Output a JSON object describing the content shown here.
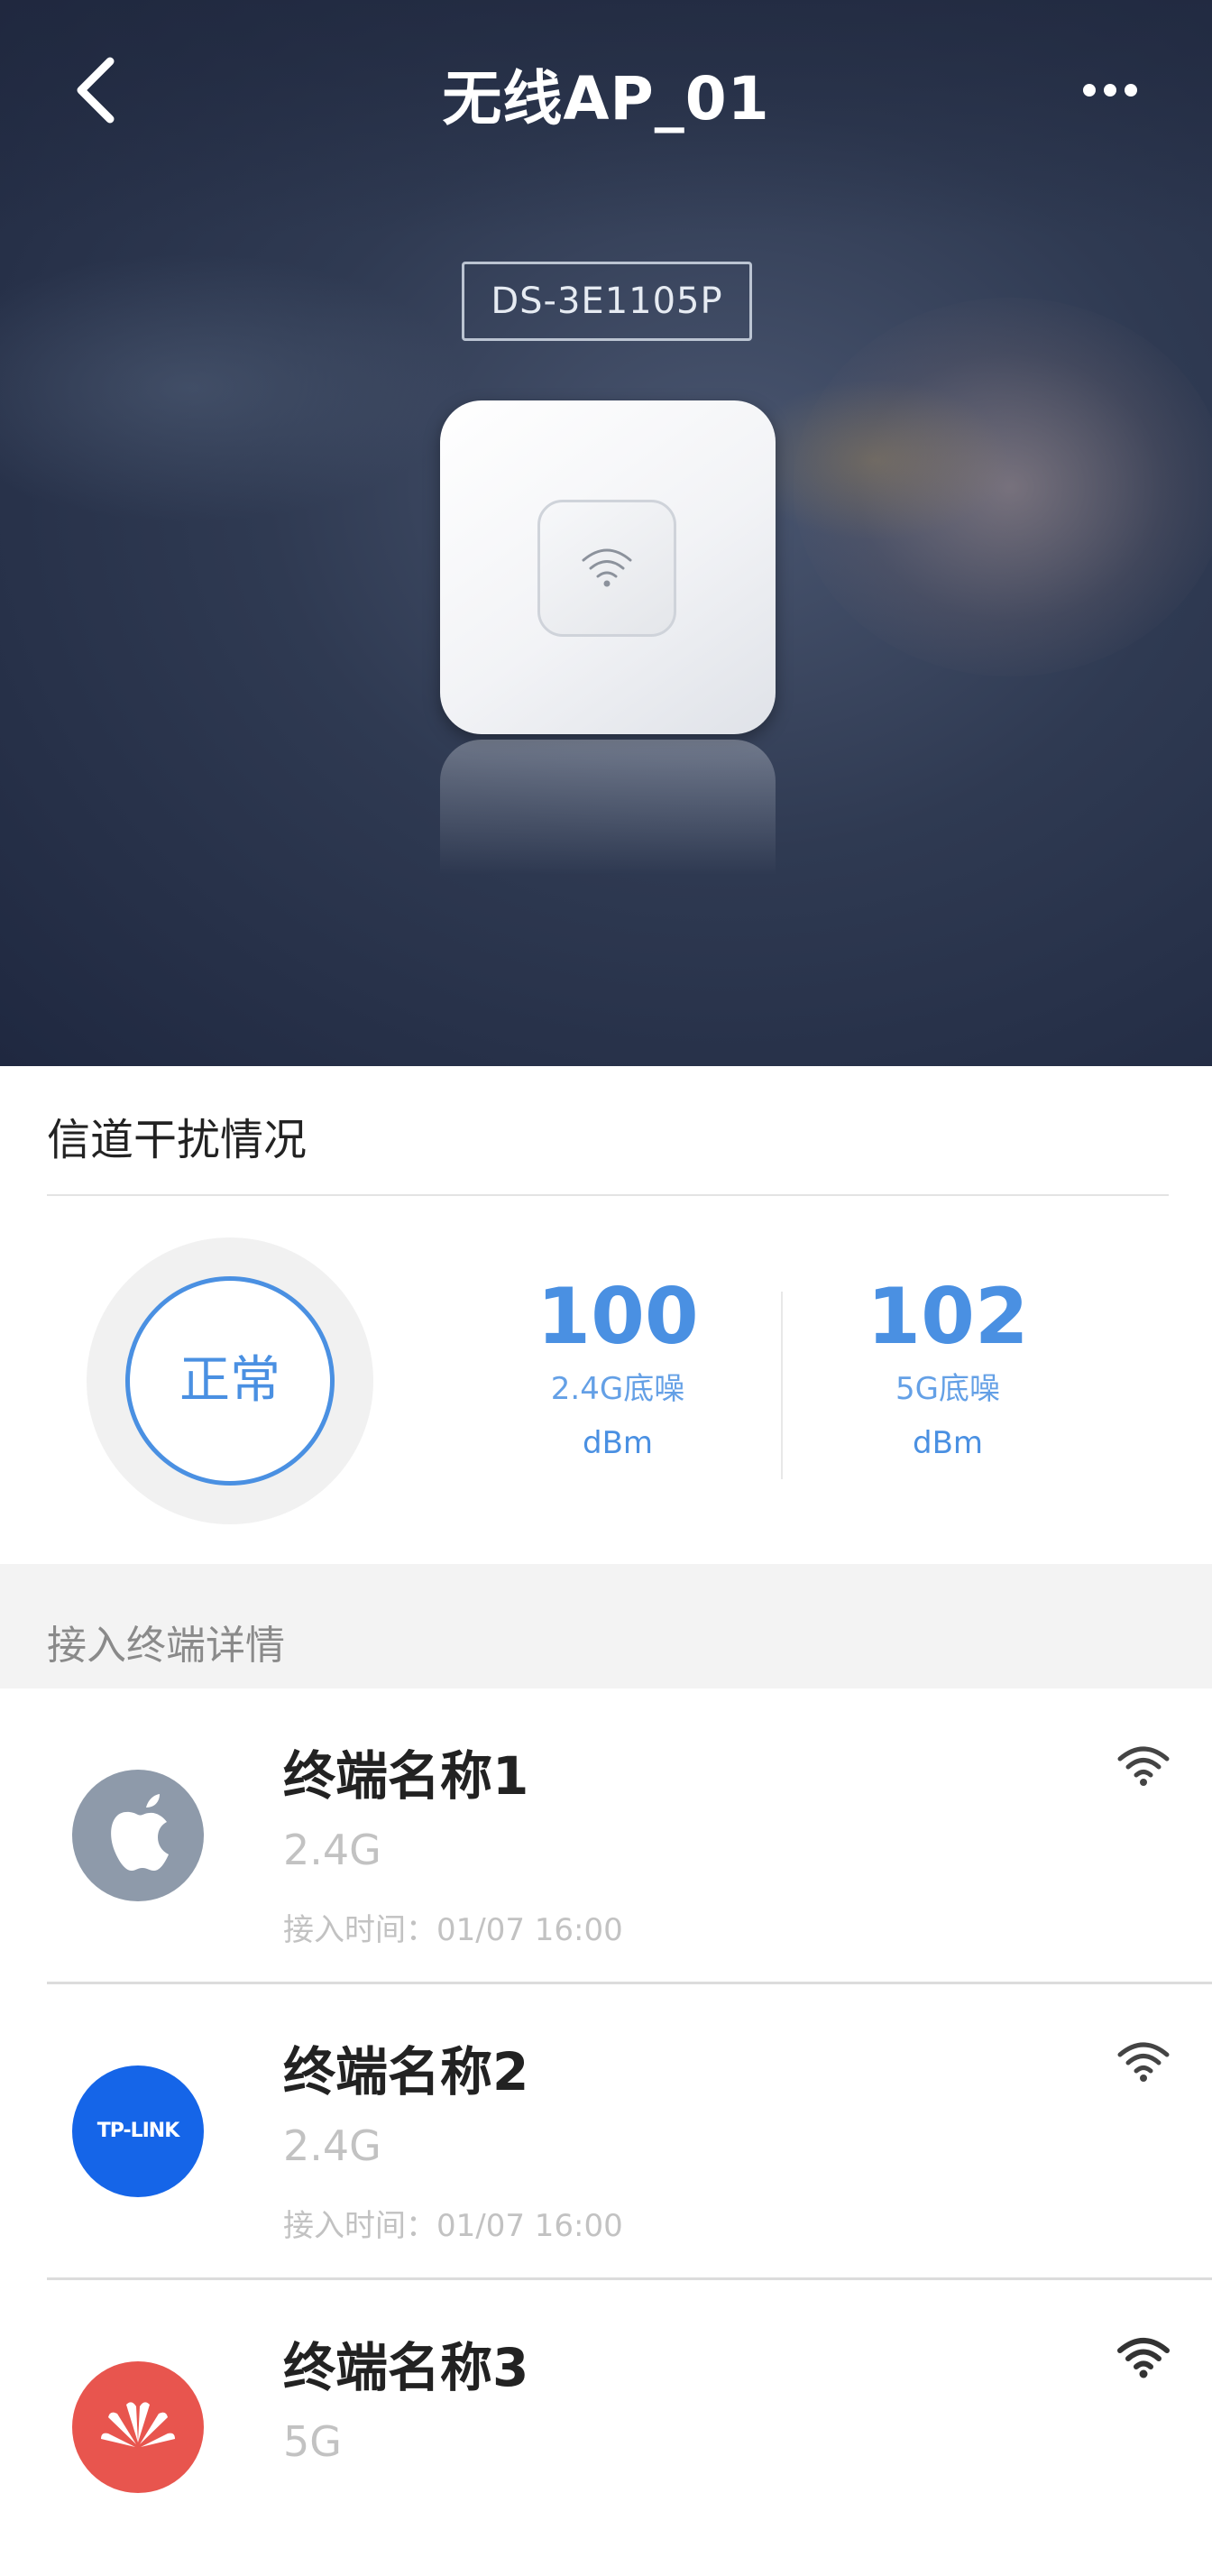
{
  "header": {
    "title": "无线AP_01",
    "back_icon": "chevron-left-icon",
    "more_icon": "more-dots-icon"
  },
  "device": {
    "model": "DS-3E1105P",
    "icon": "wifi-icon"
  },
  "channel": {
    "title": "信道干扰情况",
    "status": "正常",
    "metrics": [
      {
        "value": "100",
        "label": "2.4G底噪",
        "unit": "dBm"
      },
      {
        "value": "102",
        "label": "5G底噪",
        "unit": "dBm"
      }
    ]
  },
  "terminals": {
    "title": "接入终端详情",
    "items": [
      {
        "name": "终端名称1",
        "band": "2.4G",
        "time": "接入时间：01/07 16:00",
        "brand": "apple-logo-icon"
      },
      {
        "name": "终端名称2",
        "band": "2.4G",
        "time": "接入时间：01/07 16:00",
        "brand": "tp-link-logo-icon",
        "brand_text": "TP-LINK"
      },
      {
        "name": "终端名称3",
        "band": "5G",
        "time": "",
        "brand": "huawei-logo-icon"
      }
    ]
  },
  "colors": {
    "accent": "#4a90e2",
    "tplink": "#1565e8",
    "huawei": "#e8554e",
    "apple_bg": "#8e9aaa"
  }
}
